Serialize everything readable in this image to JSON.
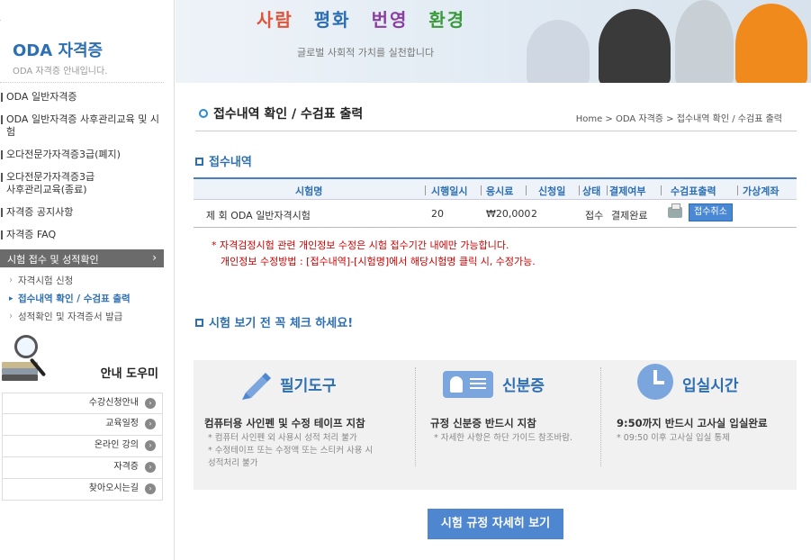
{
  "sidebar": {
    "brand_title": "ODA 자격증",
    "brand_sub": "ODA 자격증 안내입니다.",
    "menu": [
      {
        "label": "ODA 일반자격증"
      },
      {
        "label": "ODA 일반자격증 사후관리교육 및 시험"
      },
      {
        "label": "오다전문가자격증3급(폐지)"
      },
      {
        "label": "오다전문가자격증3급\n사후관리교육(종료)"
      },
      {
        "label": "자격증 공지사항"
      },
      {
        "label": "자격증 FAQ"
      }
    ],
    "active_menu": "시험 접수 및 성적확인",
    "submenu": [
      {
        "label": "자격시험 신청"
      },
      {
        "label": "접수내역 확인 / 수검표 출력"
      },
      {
        "label": "성적확인 및 자격증서 발급"
      }
    ],
    "helper_title": "안내 도우미",
    "help_items": [
      {
        "label": "수강신청안내"
      },
      {
        "label": "교육일정"
      },
      {
        "label": "온라인 강의"
      },
      {
        "label": "자격증"
      },
      {
        "label": "찾아오시는길"
      }
    ]
  },
  "banner": {
    "slogan": [
      "사람",
      "평화",
      "번영",
      "환경"
    ],
    "slogan_colors": [
      "#e0543a",
      "#2d6fb3",
      "#8a3fa0",
      "#3a9a3a"
    ],
    "subtitle": "글로벌 사회적 가치를 실천합니다"
  },
  "page": {
    "title": "접수내역 확인 / 수검표 출력",
    "breadcrumb": "Home > ODA 자격증 > 접수내역 확인 / 수검표 출력"
  },
  "receipts": {
    "section_title": "접수내역",
    "columns": [
      "시험명",
      "시행일시",
      "응시료",
      "신청일",
      "상태",
      "결제여부",
      "수검표출력",
      "가상계좌"
    ],
    "rows": [
      {
        "name": "제    회 ODA 일반자격시험",
        "date": "20",
        "fee": "₩20,000",
        "applied": "2",
        "status": "접수",
        "payment": "결제완료",
        "print_icon": "printer-icon",
        "cancel_label": "접수취소"
      }
    ]
  },
  "notice": {
    "line1": "* 자격검정시험 관련 개인정보 수정은 시험 접수기간 내에만 가능합니다.",
    "line2": "개인정보 수정방법 : [접수내역]-[시험명]에서 해당시험명 클릭 시, 수정가능."
  },
  "checklist": {
    "section_title": "시험 보기 전 꼭 체크 하세요!",
    "items": [
      {
        "icon": "pencil-icon",
        "title": "필기도구",
        "main": "컴퓨터용 사인펜  및  수정 테이프 지참",
        "desc": "* 컴퓨터 사인펜 외 사용시 성적 처리 불가\n* 수정테이프 또는 수정액 또는 스티커 사용 시\n   성적처리 불가"
      },
      {
        "icon": "id-card-icon",
        "title": "신분증",
        "main": "규정  신분증 반드시 지참",
        "desc": "* 자세한 사항은 하단 가이드 참조바람."
      },
      {
        "icon": "clock-icon",
        "title": "입실시간",
        "main": "9:50까지 반드시 고사실 입실완료",
        "desc": "* 09:50 이후 고사실 입실 통제"
      }
    ],
    "rules_button": "시험 규정 자세히 보기"
  }
}
